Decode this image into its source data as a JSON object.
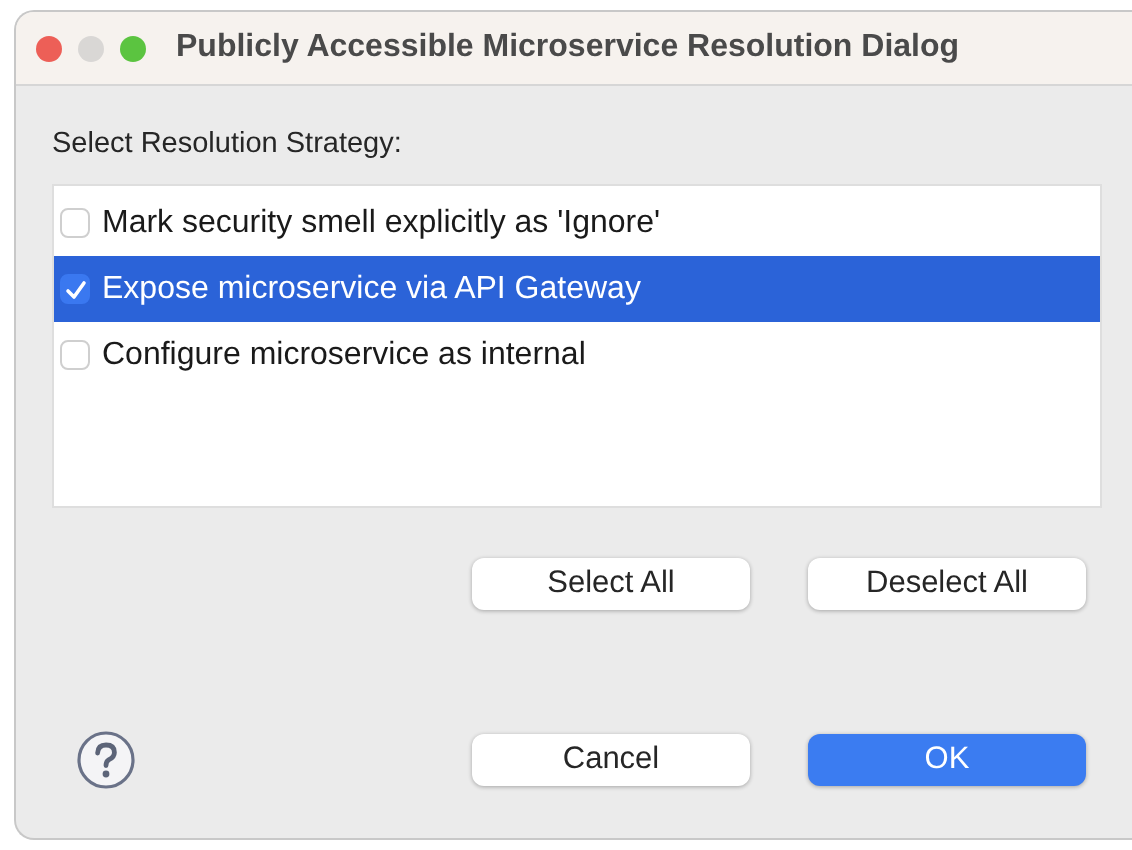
{
  "window": {
    "title": "Publicly Accessible Microservice Resolution Dialog"
  },
  "prompt": "Select Resolution Strategy:",
  "options": [
    {
      "label": "Mark security smell explicitly as 'Ignore'",
      "checked": false,
      "selected": false
    },
    {
      "label": "Expose microservice via API Gateway",
      "checked": true,
      "selected": true
    },
    {
      "label": "Configure microservice as internal",
      "checked": false,
      "selected": false
    }
  ],
  "selection_buttons": [
    "Select All",
    "Deselect All"
  ],
  "dialog_buttons": [
    {
      "label": "Cancel",
      "default": false
    },
    {
      "label": "OK",
      "default": true
    }
  ]
}
